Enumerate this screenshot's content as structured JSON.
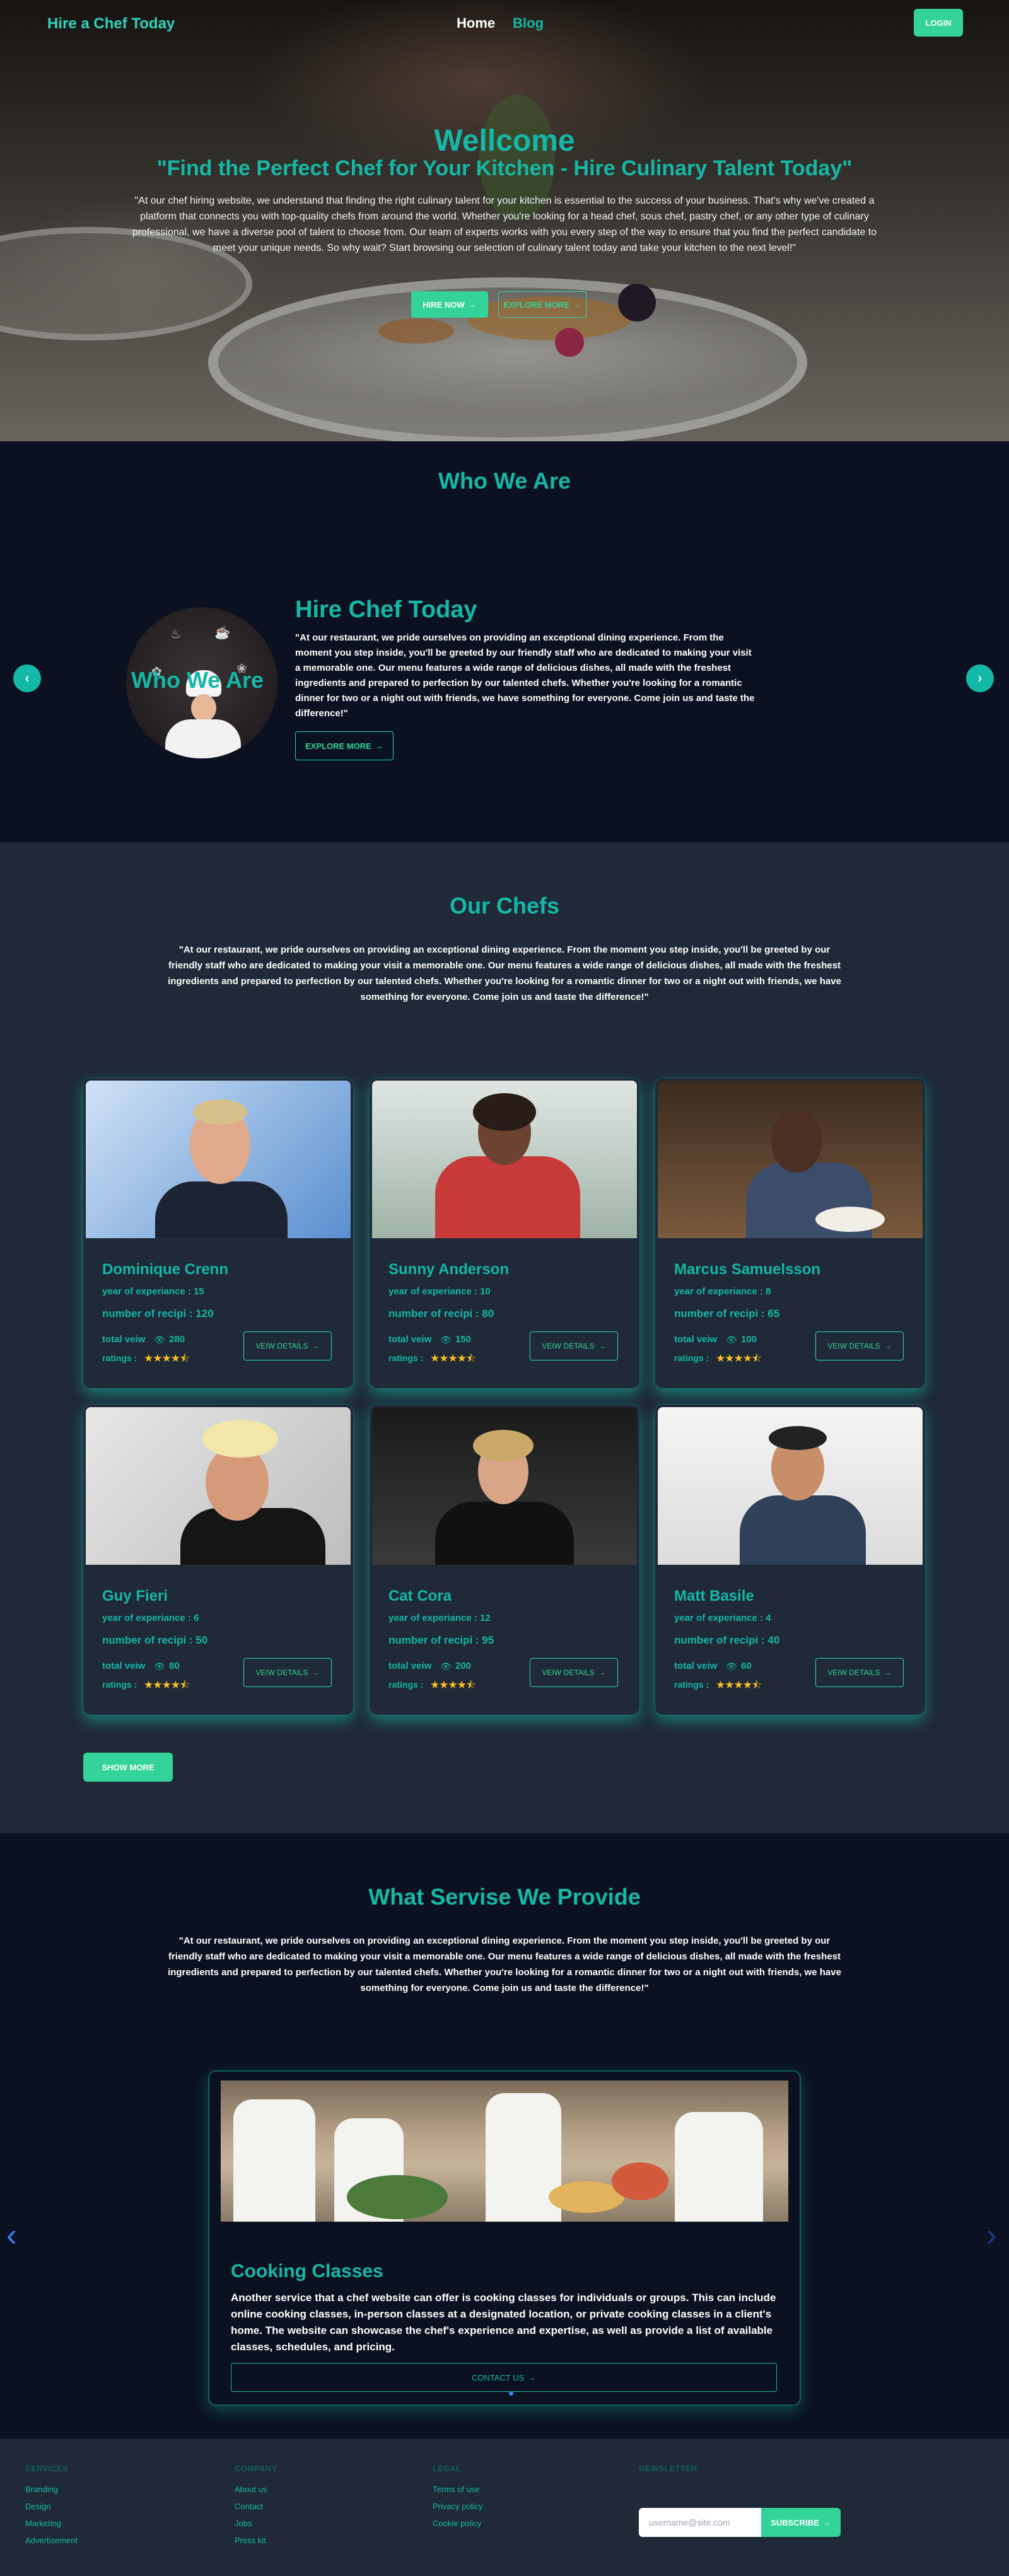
{
  "nav": {
    "brand": "Hire a Chef Today",
    "links": [
      "Home",
      "Blog"
    ],
    "login": "LOGIN"
  },
  "hero": {
    "title": "Wellcome",
    "subtitle": "\"Find the Perfect Chef for Your Kitchen - Hire Culinary Talent Today\"",
    "paragraph": "\"At our chef hiring website, we understand that finding the right culinary talent for your kitchen is essential to the success of your business. That's why we've created a platform that connects you with top-quality chefs from around the world. Whether you're looking for a head chef, sous chef, pastry chef, or any other type of culinary professional, we have a diverse pool of talent to choose from. Our team of experts works with you every step of the way to ensure that you find the perfect candidate to meet your unique needs. So why wait? Start browsing our selection of culinary talent today and take your kitchen to the next level!\"",
    "hire_button": "HIRE NOW",
    "explore_button": "EXPLORE MORE"
  },
  "who": {
    "title": "Who We Are",
    "image_overlay": "Who We Are",
    "heading": "Hire Chef Today",
    "paragraph": "\"At our restaurant, we pride ourselves on providing an exceptional dining experience. From the moment you step inside, you'll be greeted by our friendly staff who are dedicated to making your visit a memorable one. Our menu features a wide range of delicious dishes, all made with the freshest ingredients and prepared to perfection by our talented chefs. Whether you're looking for a romantic dinner for two or a night out with friends, we have something for everyone. Come join us and taste the difference!\"",
    "explore_button": "EXPLORE MORE"
  },
  "chefs": {
    "title": "Our Chefs",
    "paragraph": "\"At our restaurant, we pride ourselves on providing an exceptional dining experience. From the moment you step inside, you'll be greeted by our friendly staff who are dedicated to making your visit a memorable one. Our menu features a wide range of delicious dishes, all made with the freshest ingredients and prepared to perfection by our talented chefs. Whether you're looking for a romantic dinner for two or a night out with friends, we have something for everyone. Come join us and taste the difference!\"",
    "labels": {
      "years": "year of experiance :",
      "recipes": "number of recipi :",
      "views": "total veiw",
      "ratings": "ratings :",
      "details": "VEIW DETAILS"
    },
    "items": [
      {
        "name": "Dominique Crenn",
        "years": "year of experiance : 15",
        "recipes": "number of recipi : 120",
        "views": "280",
        "stars": "★★★★⯪"
      },
      {
        "name": "Sunny Anderson",
        "years": "year of experiance : 10",
        "recipes": "number of recipi : 80",
        "views": "150",
        "stars": "★★★★⯪"
      },
      {
        "name": "Marcus Samuelsson",
        "years": "year of experiance : 8",
        "recipes": "number of recipi : 65",
        "views": "100",
        "stars": "★★★★⯪"
      },
      {
        "name": "Guy Fieri",
        "years": "year of experiance : 6",
        "recipes": "number of recipi : 50",
        "views": "80",
        "stars": "★★★★⯪"
      },
      {
        "name": "Cat Cora",
        "years": "year of experiance : 12",
        "recipes": "number of recipi : 95",
        "views": "200",
        "stars": "★★★★⯪"
      },
      {
        "name": "Matt Basile",
        "years": "year of experiance : 4",
        "recipes": "number of recipi : 40",
        "views": "60",
        "stars": "★★★★⯪"
      }
    ],
    "show_more": "SHOW MORE"
  },
  "services": {
    "title": "What Servise We Provide",
    "paragraph": "\"At our restaurant, we pride ourselves on providing an exceptional dining experience. From the moment you step inside, you'll be greeted by our friendly staff who are dedicated to making your visit a memorable one. Our menu features a wide range of delicious dishes, all made with the freshest ingredients and prepared to perfection by our talented chefs. Whether you're looking for a romantic dinner for two or a night out with friends, we have something for everyone. Come join us and taste the difference!\"",
    "card": {
      "name": "Cooking Classes",
      "description": "Another service that a chef website can offer is cooking classes for individuals or groups. This can include online cooking classes, in-person classes at a designated location, or private cooking classes in a client's home. The website can showcase the chef's experience and expertise, as well as provide a list of available classes, schedules, and pricing.",
      "contact": "CONTACT US"
    }
  },
  "footer": {
    "services": {
      "title": "Services",
      "links": [
        "Branding",
        "Design",
        "Marketing",
        "Advertisement"
      ]
    },
    "company": {
      "title": "Company",
      "links": [
        "About us",
        "Contact",
        "Jobs",
        "Press kit"
      ]
    },
    "legal": {
      "title": "Legal",
      "links": [
        "Terms of use",
        "Privacy policy",
        "Cookie policy"
      ]
    },
    "newsletter": {
      "title": "Newsletter",
      "placeholder": "username@site.com",
      "button": "SUBSCRIBE"
    }
  },
  "colors": {
    "accent": "#14b8a6",
    "button": "#34d399",
    "star": "#fbbf24",
    "dark_bg": "#0b1120",
    "panel_bg": "#1f2937"
  },
  "icons": [
    "arrow-right-icon",
    "eye-icon",
    "star-icon",
    "chevron-left-icon",
    "chevron-right-icon"
  ]
}
